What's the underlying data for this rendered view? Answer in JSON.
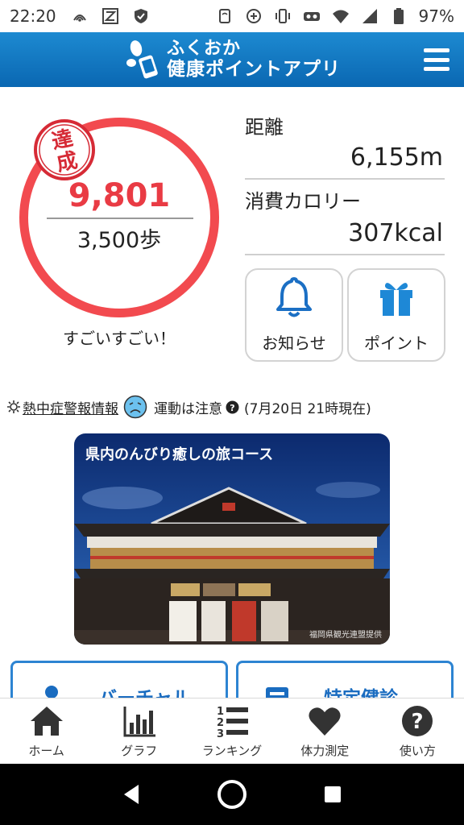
{
  "status_bar": {
    "time": "22:20",
    "battery": "97%",
    "left_icons": [
      "nfc-icon",
      "z-app-icon",
      "shield-icon"
    ],
    "right_icons": [
      "nfc-tap-icon",
      "plus-circle-icon",
      "vibrate-icon",
      "vr-icon",
      "wifi-icon",
      "signal-icon",
      "battery-icon"
    ]
  },
  "header": {
    "title_line1": "ふくおか",
    "title_line2": "健康ポイントアプリ",
    "brand_color": "#0a67b2"
  },
  "steps": {
    "achieved_stamp_top": "達",
    "achieved_stamp_bottom": "成",
    "current": "9,801",
    "goal": "3,500歩",
    "praise": "すごいすごい！",
    "ring_color": "#f24a4f",
    "progress": 1.0
  },
  "stats": {
    "distance_label": "距離",
    "distance_value": "6,155m",
    "calorie_label": "消費カロリー",
    "calorie_value": "307kcal"
  },
  "buttons": {
    "notice_label": "お知らせ",
    "point_label": "ポイント"
  },
  "heat": {
    "link": "熱中症警報情報",
    "status": "運動は注意",
    "timestamp": "(7月20日 21時現在)"
  },
  "banner": {
    "title": "県内のんびり癒しの旅コース",
    "credit": "福岡県観光連盟提供"
  },
  "cards": {
    "left_label": "バーチャル",
    "right_label": "特定健診"
  },
  "bottom_nav": [
    {
      "label": "ホーム",
      "icon": "home-icon"
    },
    {
      "label": "グラフ",
      "icon": "graph-icon"
    },
    {
      "label": "ランキング",
      "icon": "ranking-icon"
    },
    {
      "label": "体力測定",
      "icon": "heart-icon"
    },
    {
      "label": "使い方",
      "icon": "help-icon"
    }
  ]
}
